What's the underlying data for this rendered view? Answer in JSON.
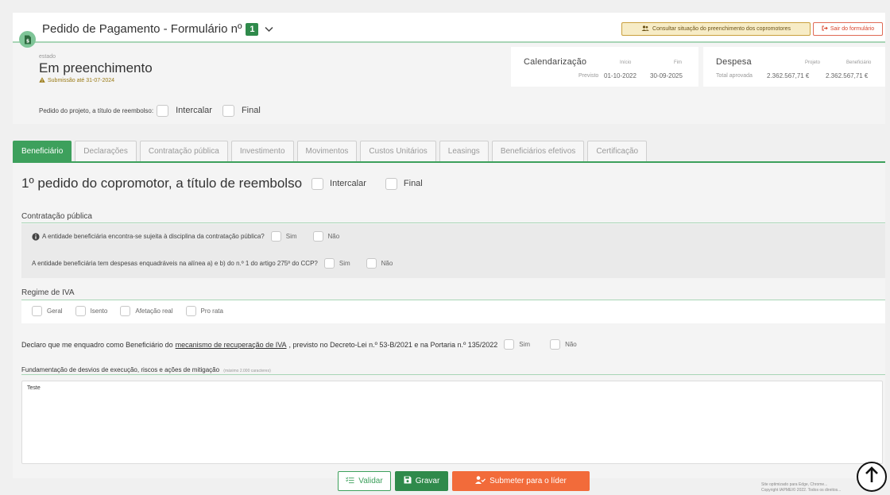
{
  "header": {
    "title": "Pedido de Pagamento - Formulário nº",
    "form_number": "1",
    "consult_button": "Consultar situação do preenchimento dos copromotores",
    "exit_button": "Sair do formulário",
    "state_label": "estado",
    "state_value": "Em preenchimento",
    "submission_note": "Submissão até 31-07-2024",
    "calendar": {
      "title": "Calendarização",
      "start_label": "Início",
      "end_label": "Fim",
      "row_label": "Previsto",
      "start_value": "01-10-2022",
      "end_value": "30-09-2025"
    },
    "expense": {
      "title": "Despesa",
      "project_label": "Projeto",
      "beneficiary_label": "Beneficiário",
      "row_label": "Total aprovada",
      "project_value": "2.362.567,71 €",
      "beneficiary_value": "2.362.567,71 €"
    },
    "reimbursement_label": "Pedido do projeto, a título de reembolso:",
    "intercalar": "Intercalar",
    "final": "Final"
  },
  "tabs": [
    {
      "label": "Beneficiário",
      "active": true
    },
    {
      "label": "Declarações"
    },
    {
      "label": "Contratação pública"
    },
    {
      "label": "Investimento"
    },
    {
      "label": "Movimentos"
    },
    {
      "label": "Custos Unitários"
    },
    {
      "label": "Leasings"
    },
    {
      "label": "Beneficiários efetivos"
    },
    {
      "label": "Certificação"
    }
  ],
  "main": {
    "title": "1º pedido do copromotor, a título de reembolso",
    "intercalar": "Intercalar",
    "final": "Final",
    "public_procurement": {
      "title": "Contratação pública",
      "q1": "A entidade beneficiária encontra-se sujeita à disciplina da contratação pública?",
      "q2": "A entidade beneficiária tem despesas enquadráveis na alínea a) e b) do n.º 1 do artigo 275º do CCP?",
      "yes": "Sim",
      "no": "Não"
    },
    "vat": {
      "title": "Regime de IVA",
      "options": [
        "Geral",
        "Isento",
        "Afetação real",
        "Pro rata"
      ]
    },
    "declaration": {
      "before": "Declaro que me enquadro como Beneficiário do",
      "link": "mecanismo de recuperação de IVA",
      "after": ", previsto no Decreto-Lei n.º 53-B/2021 e na Portaria n.º 135/2022",
      "yes": "Sim",
      "no": "Não"
    },
    "justification": {
      "label": "Fundamentação de desvios de execução, riscos e ações de mitigação",
      "hint": "(máximo 2.000 caracteres)",
      "value": "Teste"
    }
  },
  "actions": {
    "validate": "Validar",
    "save": "Gravar",
    "submit": "Submeter para o líder"
  },
  "footer": {
    "line1": "Site optimizado para Edge, Chrome...",
    "line2": "Copyright IAPMEI© 2022. Todos os direitos..."
  },
  "colors": {
    "accent": "#3da05c",
    "accent_dark": "#2f8a4b",
    "submit": "#f26b3a",
    "warning": "#c9a03d",
    "danger": "#d9432b"
  }
}
